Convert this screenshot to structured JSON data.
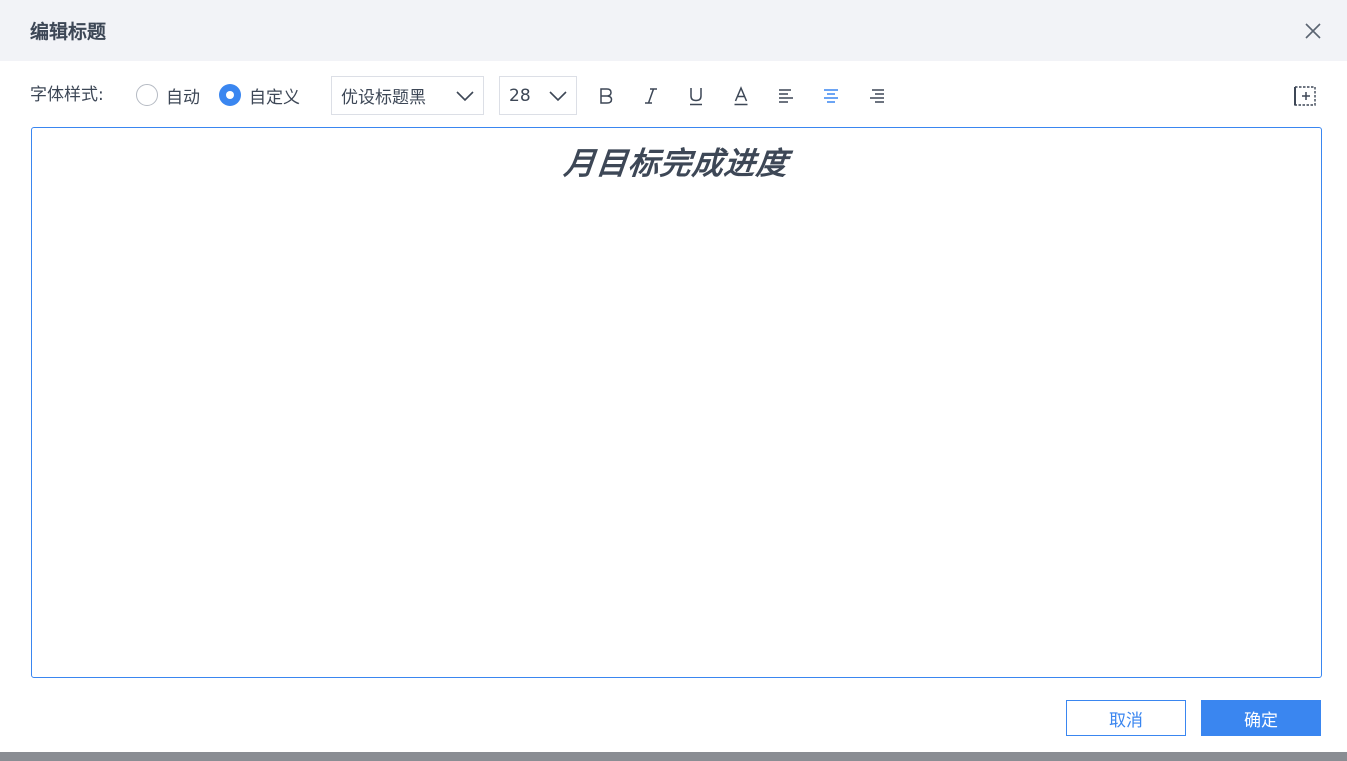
{
  "dialog": {
    "title": "编辑标题"
  },
  "toolbar": {
    "font_style_label": "字体样式:",
    "radio_auto_label": "自动",
    "radio_custom_label": "自定义",
    "selected_mode": "custom",
    "font_family_value": "优设标题黑",
    "font_size_value": "28",
    "bold_glyph": "B",
    "italic_glyph": "I",
    "underline_glyph": "U",
    "color_glyph": "A",
    "active_alignment": "center"
  },
  "editor": {
    "title_text": "月目标完成进度"
  },
  "footer": {
    "cancel_label": "取消",
    "ok_label": "确定"
  },
  "colors": {
    "accent": "#3a86f0",
    "text": "#3d4756",
    "header_bg": "#f2f3f7"
  },
  "icons": {
    "close": "close-icon",
    "chevron": "chevron-down-icon",
    "align_left": "align-left-icon",
    "align_center": "align-center-icon",
    "align_right": "align-right-icon",
    "insert_field": "insert-field-icon"
  }
}
